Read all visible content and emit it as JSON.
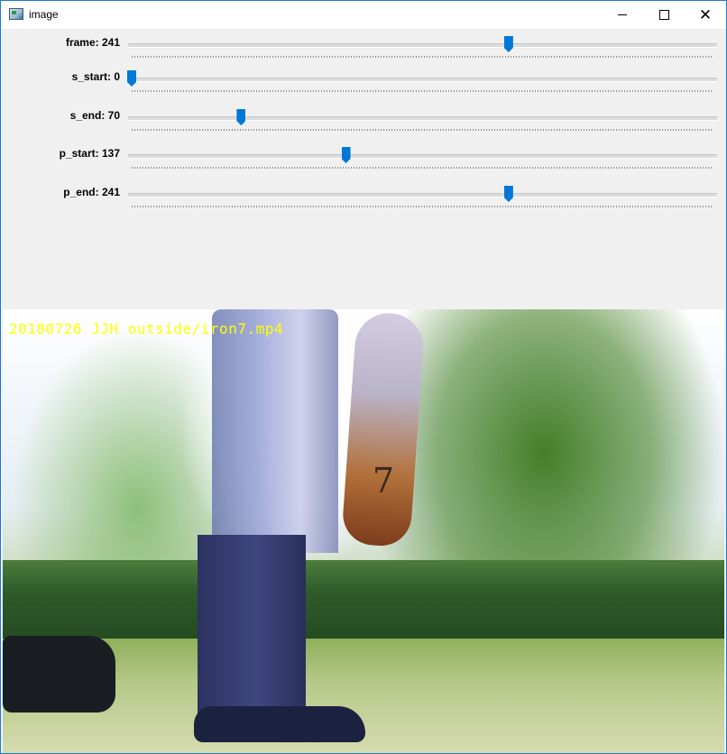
{
  "window": {
    "title": "image",
    "icon": "app-image-icon",
    "controls": {
      "minimize_icon": "minimize-icon",
      "maximize_icon": "maximize-icon",
      "close_icon": "close-icon",
      "close_glyph": "✕"
    }
  },
  "trackbars": [
    {
      "label": "frame: 241",
      "value": 241,
      "max": 372
    },
    {
      "label": "s_start: 0",
      "value": 0,
      "max": 372
    },
    {
      "label": "s_end: 70",
      "value": 70,
      "max": 372
    },
    {
      "label": "p_start: 137",
      "value": 137,
      "max": 372
    },
    {
      "label": "p_end: 241",
      "value": 241,
      "max": 372
    }
  ],
  "video": {
    "overlay_text": "20180726 JJH outside/iron7.mp4",
    "head_cover_number": "7"
  },
  "colors": {
    "accent": "#0078d7",
    "window_border": "#1e78c8",
    "overlay_text": "#ffff00"
  }
}
